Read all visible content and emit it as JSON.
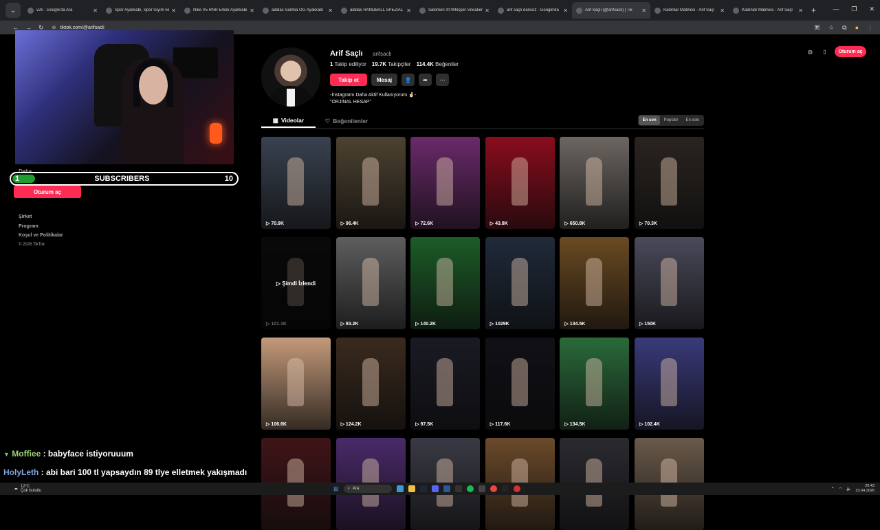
{
  "browser": {
    "tabs": [
      {
        "title": "v2k - Google'da Ara",
        "icon": "google-icon"
      },
      {
        "title": "Spor Ayakkabı, Spor Giyim ve",
        "icon": "site-icon"
      },
      {
        "title": "Nike V5 RNR Erkek Ayakkabı",
        "icon": "nike-icon"
      },
      {
        "title": "adidas Samba OG Ayakkabı",
        "icon": "adidas-icon"
      },
      {
        "title": "adidas HANDBALL SPEZIAL U",
        "icon": "adidas-icon"
      },
      {
        "title": "Salomon Xt-Whisper Sneaker",
        "icon": "salomon-icon"
      },
      {
        "title": "arif saçlı dansöz - Google'da",
        "icon": "google-icon"
      },
      {
        "title": "Arif Saçlı (@arifsacli) | Tik",
        "icon": "tiktok-icon",
        "active": true
      },
      {
        "title": "Kadınlar Matinesi - Arif Saçl",
        "icon": "site-icon"
      },
      {
        "title": "Kadınlar Matinesi - Arif Saçl",
        "icon": "site-icon"
      }
    ],
    "url": "tiktok.com/@arifsacli"
  },
  "stream": {
    "subs_start": "1",
    "subs_label": "SUBSCRIBERS",
    "subs_goal": "10",
    "subs_progress": 0.1
  },
  "sidebar": {
    "more_label": "Daha...",
    "login_label": "Oturum aç",
    "footer": [
      "Şirket",
      "Program",
      "Koşul ve Politikalar"
    ],
    "copyright": "© 2026 TikTok"
  },
  "header": {
    "login_label": "Oturum aç"
  },
  "profile": {
    "name": "Arif Saçlı",
    "username": "arifsacli",
    "following_count": "1",
    "following_label": "Takip ediliyor",
    "followers_count": "19.7K",
    "followers_label": "Takipçiler",
    "likes_count": "114.4K",
    "likes_label": "Beğeniler",
    "follow_label": "Takip et",
    "message_label": "Mesaj",
    "bio": "-İnstagramı Daha Aktif Kullanıyorum 🤞🏻-\n\"ORJİNAL HESAP\""
  },
  "tabs": {
    "videos": "Videolar",
    "liked": "Beğenilenler"
  },
  "sort": [
    "En son",
    "Popüler",
    "En eski"
  ],
  "videos": [
    {
      "views": "70.9K",
      "bg": "#3a4250"
    },
    {
      "views": "96.4K",
      "bg": "#4d4230"
    },
    {
      "views": "72.6K",
      "bg": "#6a2a6a"
    },
    {
      "views": "43.8K",
      "bg": "#8a0c1c"
    },
    {
      "views": "650.8K",
      "bg": "#6c6662"
    },
    {
      "views": "70.3K",
      "bg": "#2a2420"
    },
    {
      "views": "101.1K",
      "bg": "#151515",
      "now": "Şimdi İzlendi"
    },
    {
      "views": "83.2K",
      "bg": "#5e5e5e"
    },
    {
      "views": "140.2K",
      "bg": "#1c5c28"
    },
    {
      "views": "1029K",
      "bg": "#202a3a"
    },
    {
      "views": "134.5K",
      "bg": "#6a4a22"
    },
    {
      "views": "150K",
      "bg": "#4a4a5a"
    },
    {
      "views": "106.6K",
      "bg": "#c49a7a"
    },
    {
      "views": "124.2K",
      "bg": "#3a2a1e"
    },
    {
      "views": "97.5K",
      "bg": "#1a1a24"
    },
    {
      "views": "117.6K",
      "bg": "#101016"
    },
    {
      "views": "134.5K",
      "bg": "#2a6a3a"
    },
    {
      "views": "102.4K",
      "bg": "#3a3a7a"
    },
    {
      "views": "",
      "bg": "#401418"
    },
    {
      "views": "",
      "bg": "#4a2a6a"
    },
    {
      "views": "",
      "bg": "#3a3a44"
    },
    {
      "views": "",
      "bg": "#6a4a2a"
    },
    {
      "views": "",
      "bg": "#2a2a30"
    },
    {
      "views": "",
      "bg": "#6a5a4a"
    }
  ],
  "chat": [
    {
      "user": "Moffiee",
      "text": " : babyface istiyoruuum"
    },
    {
      "user": "HolyLeth",
      "text": " : abi bari 100 tl yapsaydın 89 tlye elletmek yakışmadı"
    }
  ],
  "taskbar": {
    "temp": "12°C",
    "weather": "Çok bulutlu",
    "search": "Ara",
    "time": "20:43",
    "date": "23.04.2026"
  }
}
